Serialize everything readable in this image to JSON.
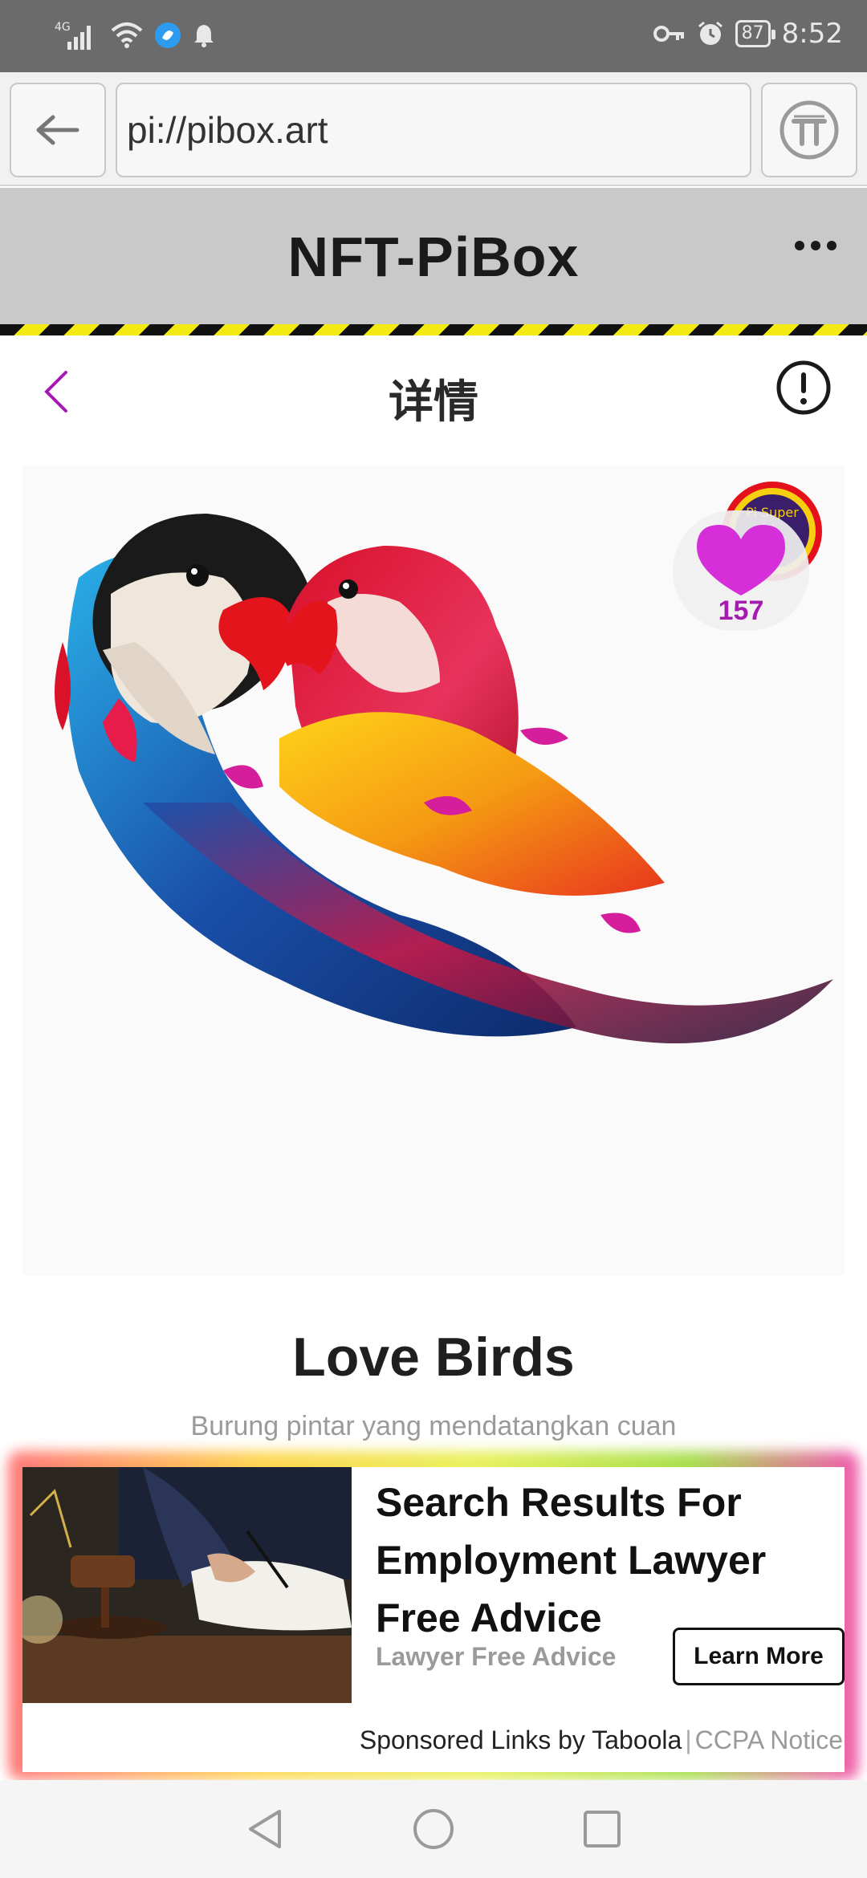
{
  "status_bar": {
    "network": "4G",
    "battery": "87",
    "time": "8:52"
  },
  "browser": {
    "url": "pi://pibox.art"
  },
  "app": {
    "title": "NFT-PiBox"
  },
  "detail": {
    "title": "详情",
    "badge_text": "Pi Super",
    "likes": "157",
    "nft_title": "Love Birds",
    "nft_subtitle": "Burung pintar yang mendatangkan cuan"
  },
  "ad": {
    "headline": "Search Results For Employment Lawyer Free Advice",
    "source": "Lawyer Free Advice",
    "cta": "Learn More",
    "sponsored": "Sponsored Links by Taboola",
    "separator": "|",
    "notice": "CCPA Notice"
  },
  "colors": {
    "accent_purple": "#a51bb0",
    "heart_magenta": "#d62fd9",
    "hazard_yellow": "#f2ea12",
    "header_gray": "#c9c9c9",
    "status_gray": "#6b6b6b"
  }
}
